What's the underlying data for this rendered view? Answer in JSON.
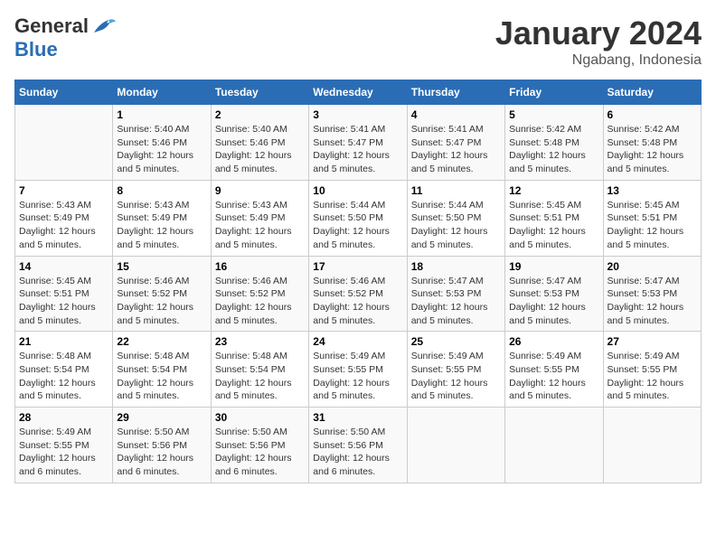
{
  "logo": {
    "general": "General",
    "blue": "Blue"
  },
  "header": {
    "month": "January 2024",
    "location": "Ngabang, Indonesia"
  },
  "days_of_week": [
    "Sunday",
    "Monday",
    "Tuesday",
    "Wednesday",
    "Thursday",
    "Friday",
    "Saturday"
  ],
  "weeks": [
    [
      {
        "day": "",
        "info": ""
      },
      {
        "day": "1",
        "info": "Sunrise: 5:40 AM\nSunset: 5:46 PM\nDaylight: 12 hours\nand 5 minutes."
      },
      {
        "day": "2",
        "info": "Sunrise: 5:40 AM\nSunset: 5:46 PM\nDaylight: 12 hours\nand 5 minutes."
      },
      {
        "day": "3",
        "info": "Sunrise: 5:41 AM\nSunset: 5:47 PM\nDaylight: 12 hours\nand 5 minutes."
      },
      {
        "day": "4",
        "info": "Sunrise: 5:41 AM\nSunset: 5:47 PM\nDaylight: 12 hours\nand 5 minutes."
      },
      {
        "day": "5",
        "info": "Sunrise: 5:42 AM\nSunset: 5:48 PM\nDaylight: 12 hours\nand 5 minutes."
      },
      {
        "day": "6",
        "info": "Sunrise: 5:42 AM\nSunset: 5:48 PM\nDaylight: 12 hours\nand 5 minutes."
      }
    ],
    [
      {
        "day": "7",
        "info": "Sunrise: 5:43 AM\nSunset: 5:49 PM\nDaylight: 12 hours\nand 5 minutes."
      },
      {
        "day": "8",
        "info": "Sunrise: 5:43 AM\nSunset: 5:49 PM\nDaylight: 12 hours\nand 5 minutes."
      },
      {
        "day": "9",
        "info": "Sunrise: 5:43 AM\nSunset: 5:49 PM\nDaylight: 12 hours\nand 5 minutes."
      },
      {
        "day": "10",
        "info": "Sunrise: 5:44 AM\nSunset: 5:50 PM\nDaylight: 12 hours\nand 5 minutes."
      },
      {
        "day": "11",
        "info": "Sunrise: 5:44 AM\nSunset: 5:50 PM\nDaylight: 12 hours\nand 5 minutes."
      },
      {
        "day": "12",
        "info": "Sunrise: 5:45 AM\nSunset: 5:51 PM\nDaylight: 12 hours\nand 5 minutes."
      },
      {
        "day": "13",
        "info": "Sunrise: 5:45 AM\nSunset: 5:51 PM\nDaylight: 12 hours\nand 5 minutes."
      }
    ],
    [
      {
        "day": "14",
        "info": "Sunrise: 5:45 AM\nSunset: 5:51 PM\nDaylight: 12 hours\nand 5 minutes."
      },
      {
        "day": "15",
        "info": "Sunrise: 5:46 AM\nSunset: 5:52 PM\nDaylight: 12 hours\nand 5 minutes."
      },
      {
        "day": "16",
        "info": "Sunrise: 5:46 AM\nSunset: 5:52 PM\nDaylight: 12 hours\nand 5 minutes."
      },
      {
        "day": "17",
        "info": "Sunrise: 5:46 AM\nSunset: 5:52 PM\nDaylight: 12 hours\nand 5 minutes."
      },
      {
        "day": "18",
        "info": "Sunrise: 5:47 AM\nSunset: 5:53 PM\nDaylight: 12 hours\nand 5 minutes."
      },
      {
        "day": "19",
        "info": "Sunrise: 5:47 AM\nSunset: 5:53 PM\nDaylight: 12 hours\nand 5 minutes."
      },
      {
        "day": "20",
        "info": "Sunrise: 5:47 AM\nSunset: 5:53 PM\nDaylight: 12 hours\nand 5 minutes."
      }
    ],
    [
      {
        "day": "21",
        "info": "Sunrise: 5:48 AM\nSunset: 5:54 PM\nDaylight: 12 hours\nand 5 minutes."
      },
      {
        "day": "22",
        "info": "Sunrise: 5:48 AM\nSunset: 5:54 PM\nDaylight: 12 hours\nand 5 minutes."
      },
      {
        "day": "23",
        "info": "Sunrise: 5:48 AM\nSunset: 5:54 PM\nDaylight: 12 hours\nand 5 minutes."
      },
      {
        "day": "24",
        "info": "Sunrise: 5:49 AM\nSunset: 5:55 PM\nDaylight: 12 hours\nand 5 minutes."
      },
      {
        "day": "25",
        "info": "Sunrise: 5:49 AM\nSunset: 5:55 PM\nDaylight: 12 hours\nand 5 minutes."
      },
      {
        "day": "26",
        "info": "Sunrise: 5:49 AM\nSunset: 5:55 PM\nDaylight: 12 hours\nand 5 minutes."
      },
      {
        "day": "27",
        "info": "Sunrise: 5:49 AM\nSunset: 5:55 PM\nDaylight: 12 hours\nand 5 minutes."
      }
    ],
    [
      {
        "day": "28",
        "info": "Sunrise: 5:49 AM\nSunset: 5:55 PM\nDaylight: 12 hours\nand 6 minutes."
      },
      {
        "day": "29",
        "info": "Sunrise: 5:50 AM\nSunset: 5:56 PM\nDaylight: 12 hours\nand 6 minutes."
      },
      {
        "day": "30",
        "info": "Sunrise: 5:50 AM\nSunset: 5:56 PM\nDaylight: 12 hours\nand 6 minutes."
      },
      {
        "day": "31",
        "info": "Sunrise: 5:50 AM\nSunset: 5:56 PM\nDaylight: 12 hours\nand 6 minutes."
      },
      {
        "day": "",
        "info": ""
      },
      {
        "day": "",
        "info": ""
      },
      {
        "day": "",
        "info": ""
      }
    ]
  ]
}
